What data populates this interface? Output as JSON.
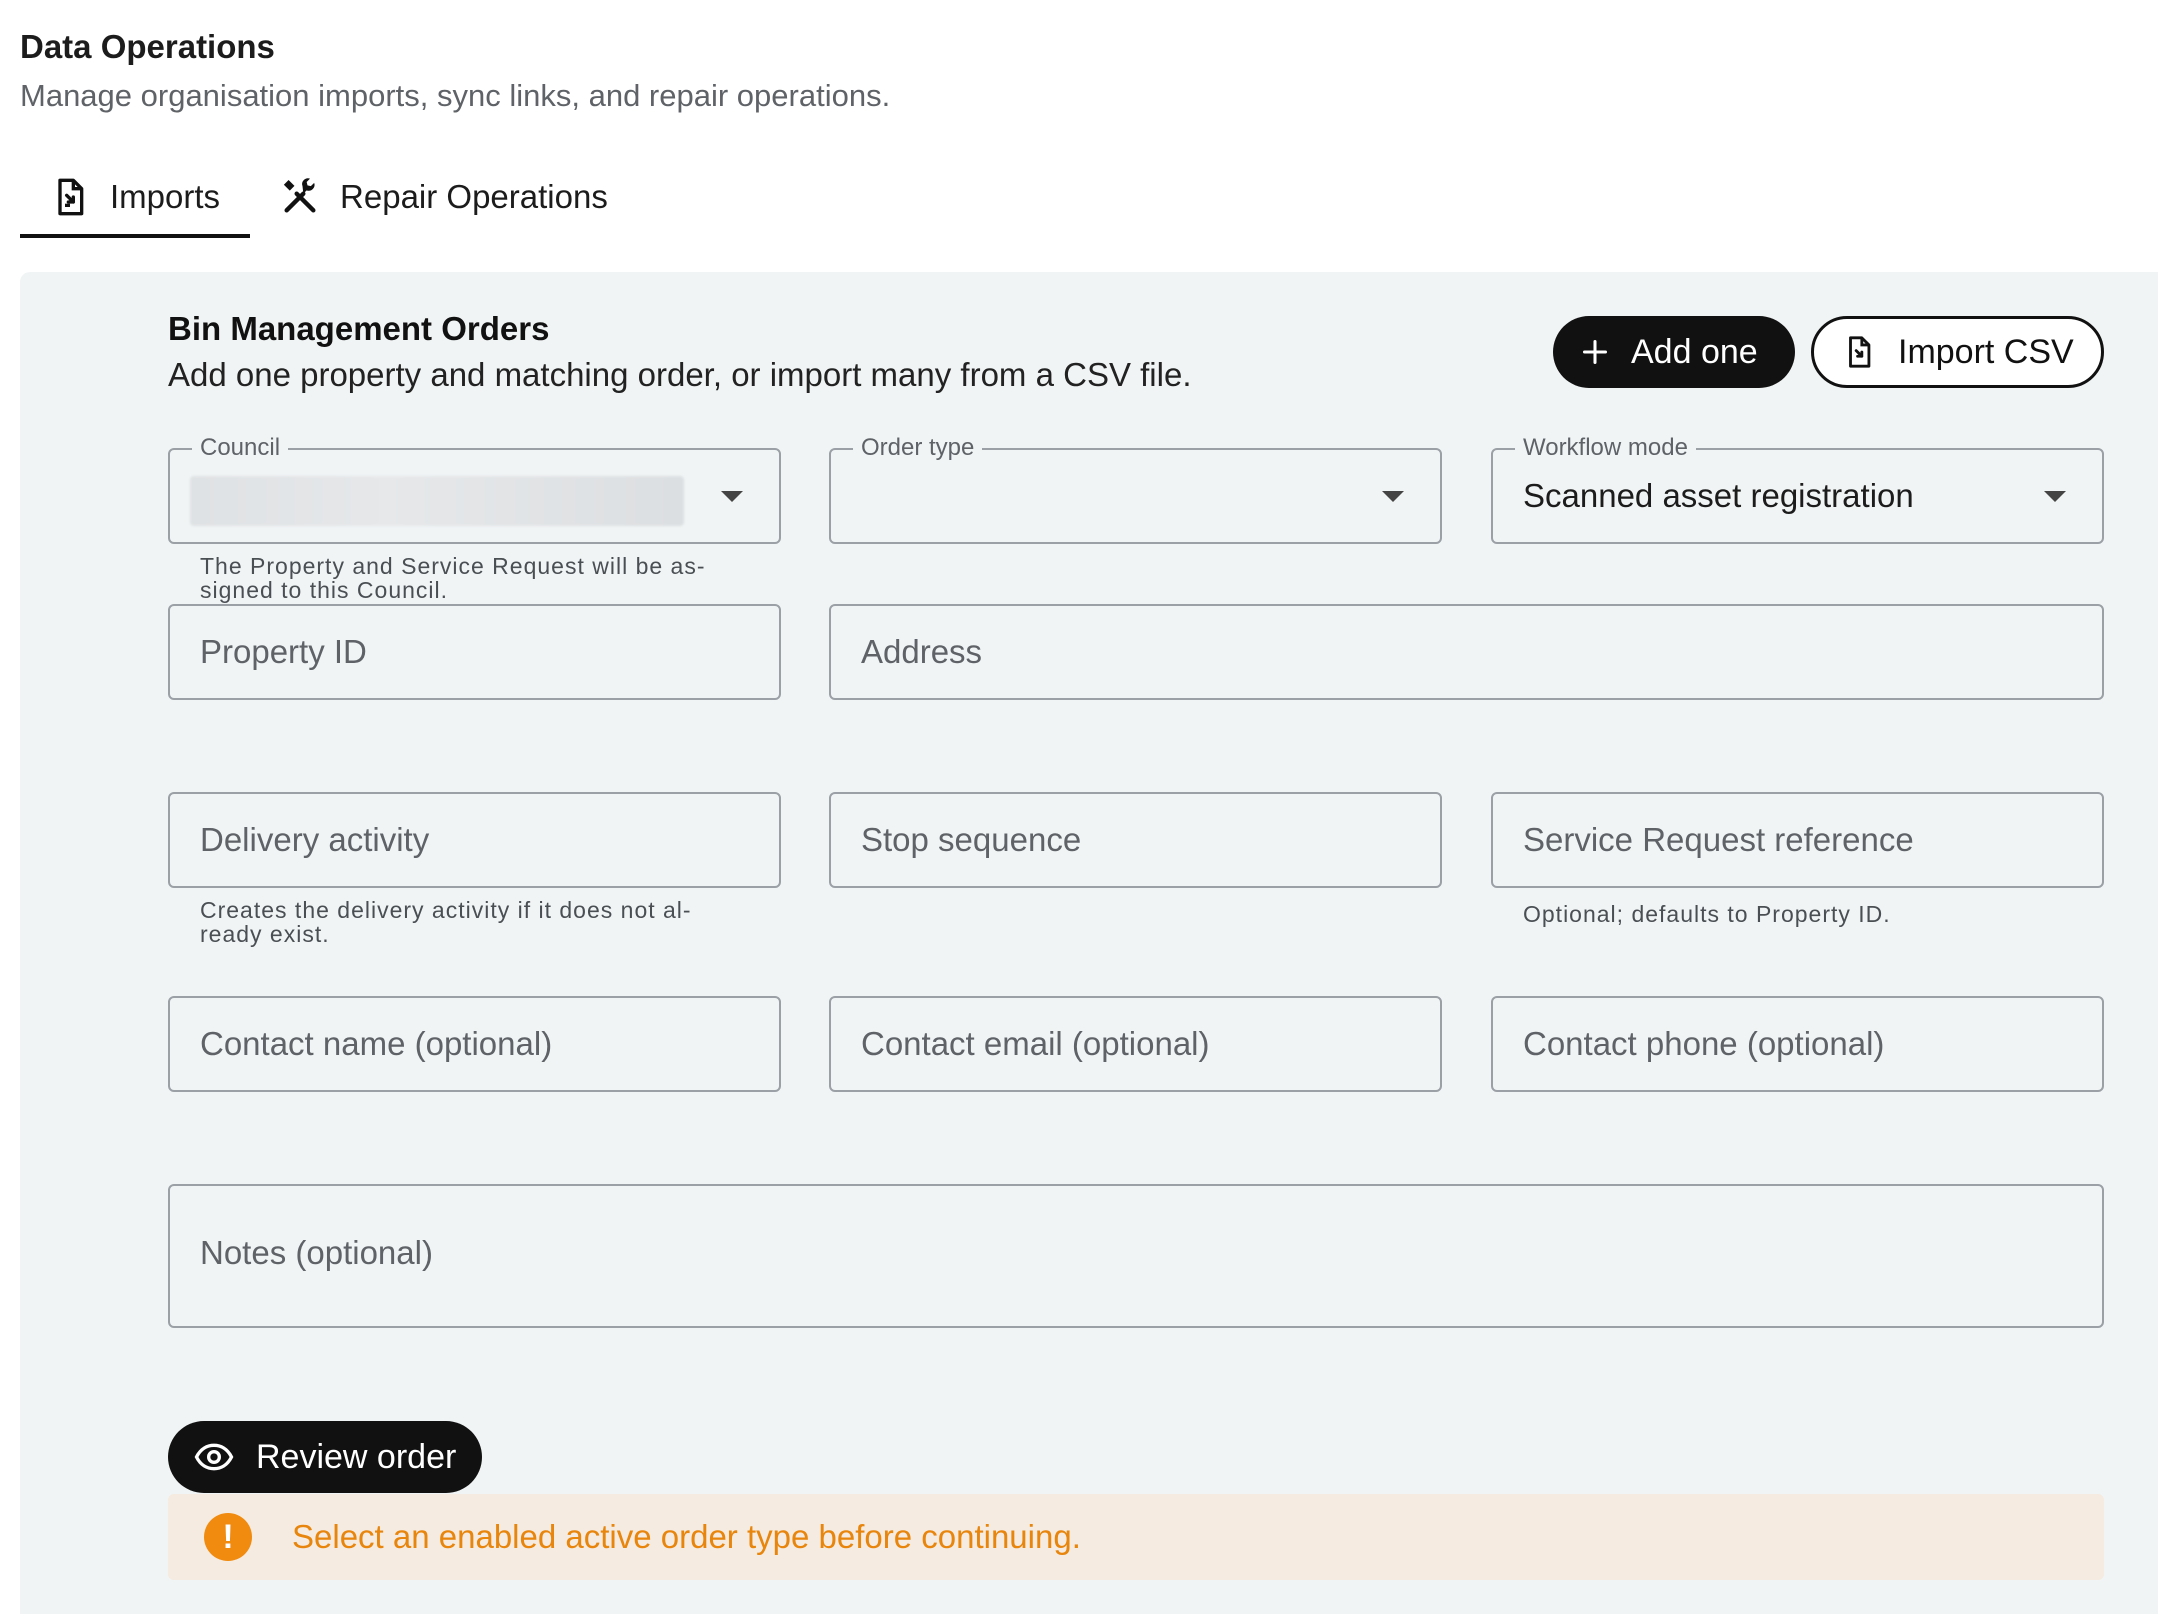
{
  "page": {
    "title": "Data Operations",
    "subtitle": "Manage organisation imports, sync links, and repair operations."
  },
  "tabs": [
    {
      "label": "Imports",
      "icon": "import-file-icon",
      "active": true
    },
    {
      "label": "Repair Operations",
      "icon": "tools-icon",
      "active": false
    }
  ],
  "section": {
    "title": "Bin Management Orders",
    "description": "Add one property and matching order, or import many from a CSV file.",
    "add_one_label": "Add one",
    "import_csv_label": "Import CSV"
  },
  "form": {
    "council": {
      "label": "Council",
      "helper": "The Property and Service Request will be as-\nsigned to this Council."
    },
    "order_type": {
      "label": "Order type",
      "value": ""
    },
    "workflow_mode": {
      "label": "Workflow mode",
      "value": "Scanned asset registration"
    },
    "property_id": {
      "placeholder": "Property ID"
    },
    "address": {
      "placeholder": "Address"
    },
    "delivery_activity": {
      "placeholder": "Delivery activity",
      "helper": "Creates the delivery activity if it does not al-\nready exist."
    },
    "stop_sequence": {
      "placeholder": "Stop sequence"
    },
    "service_request_reference": {
      "placeholder": "Service Request reference",
      "helper": "Optional; defaults to Property ID."
    },
    "contact_name": {
      "placeholder": "Contact name (optional)"
    },
    "contact_email": {
      "placeholder": "Contact email (optional)"
    },
    "contact_phone": {
      "placeholder": "Contact phone (optional)"
    },
    "notes": {
      "placeholder": "Notes (optional)"
    }
  },
  "actions": {
    "review_label": "Review order"
  },
  "alert": {
    "icon": "exclamation-icon",
    "message": "Select an enabled active order type before continuing.",
    "color": "#e8850c"
  }
}
